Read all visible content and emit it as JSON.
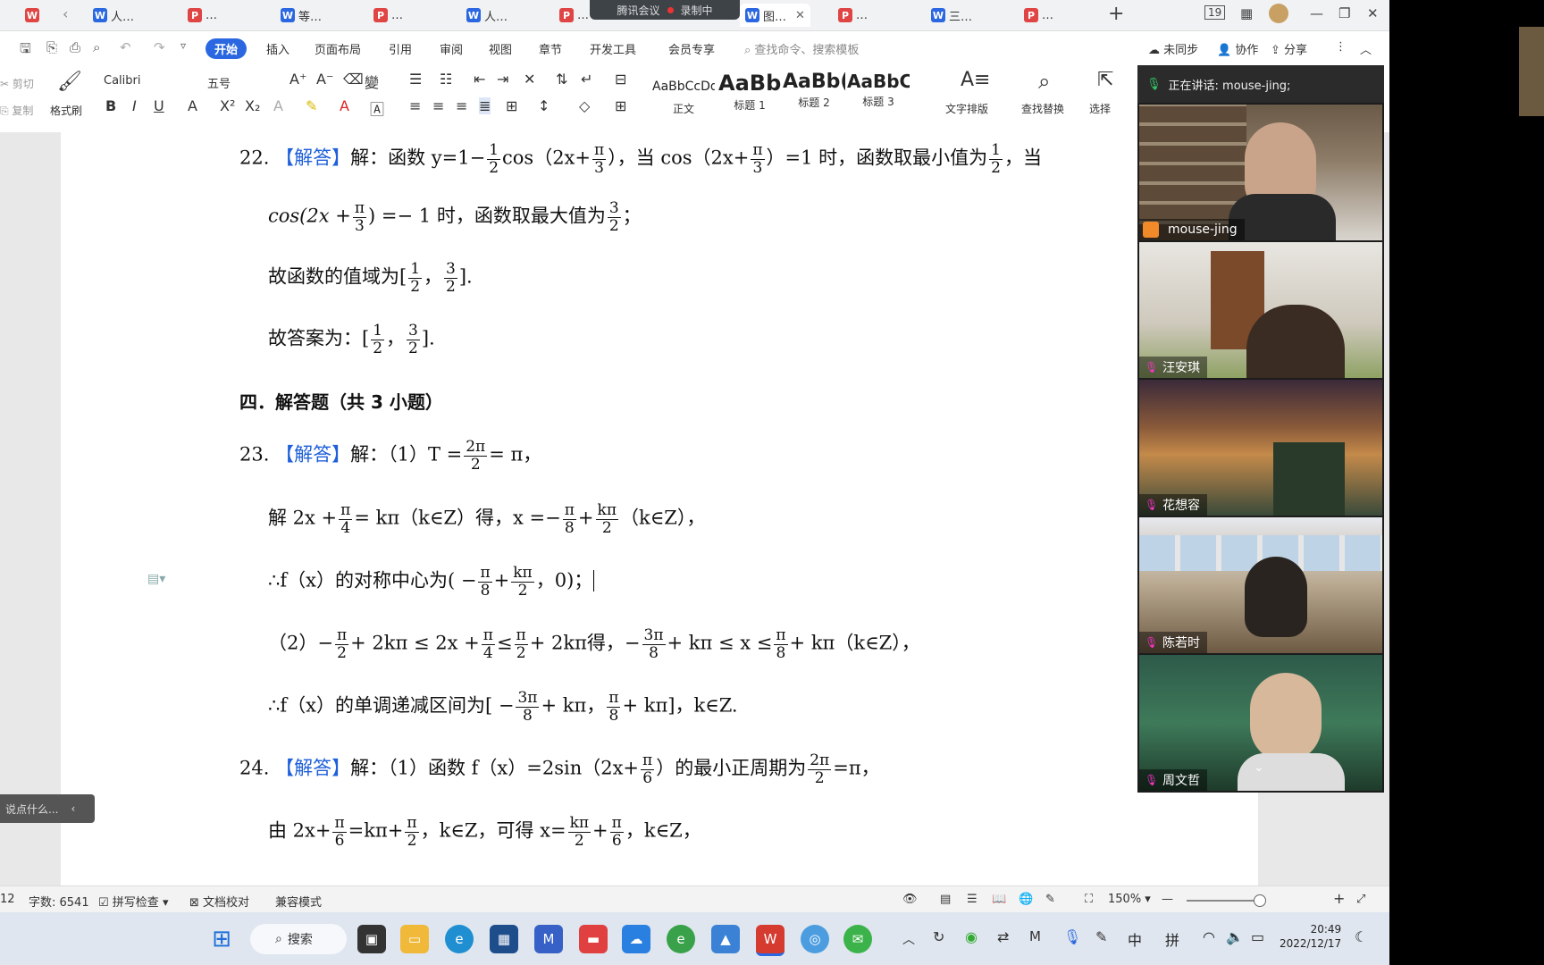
{
  "tabs": [
    {
      "label": "人…",
      "type": "w"
    },
    {
      "label": "…",
      "type": "p"
    },
    {
      "label": "等…",
      "type": "w"
    },
    {
      "label": "…",
      "type": "p"
    },
    {
      "label": "人…",
      "type": "w"
    },
    {
      "label": "…",
      "type": "p"
    },
    {
      "label": "图…",
      "type": "w",
      "active": true
    },
    {
      "label": "…",
      "type": "p"
    },
    {
      "label": "三…",
      "type": "w"
    },
    {
      "label": "…",
      "type": "p"
    }
  ],
  "meeting": {
    "app": "腾讯会议",
    "recording": "录制中"
  },
  "window": {
    "badge": "19"
  },
  "menu": {
    "items": [
      "开始",
      "插入",
      "页面布局",
      "引用",
      "审阅",
      "视图",
      "章节",
      "开发工具",
      "会员专享"
    ],
    "search_placeholder": "查找命令、搜索模板",
    "sync": "未同步",
    "collab": "协作",
    "share": "分享"
  },
  "ribbon": {
    "cut": "剪切",
    "copy": "复制",
    "format_painter": "格式刷",
    "font": "Calibri",
    "size": "五号",
    "styles": [
      {
        "preview": "AaBbCcDd",
        "label": "正文"
      },
      {
        "preview": "AaBb",
        "label": "标题 1"
      },
      {
        "preview": "AaBb(",
        "label": "标题 2"
      },
      {
        "preview": "AaBbC",
        "label": "标题 3"
      }
    ],
    "text_layout": "文字排版",
    "find_replace": "查找替换",
    "select": "选择"
  },
  "doc": {
    "l1a": "22.",
    "l1b": "【解答】",
    "l1c": "解：函数 y=1−",
    "l1d": "cos（2x+",
    "l1e": "），当 cos（2x+",
    "l1f": "）=1 时，函数取最小值为",
    "l1g": "，当",
    "l2a": "cos(2x +",
    "l2b": ") =− 1 时，函数取最大值为",
    "l2c": "；",
    "l3a": "故函数的值域为[",
    "l3b": "，",
    "l3c": "].",
    "l4a": "故答案为：[",
    "l4b": "，",
    "l4c": "].",
    "sec": "四．解答题（共 3 小题）",
    "l5a": "23.",
    "l5b": "【解答】",
    "l5c": "解：（1）T =",
    "l5d": "= π，",
    "l6a": "解 2x +",
    "l6b": "= kπ（k∈Z）得，x =−",
    "l6c": "+",
    "l6d": "（k∈Z），",
    "l7a": "∴f（x）的对称中心为( −",
    "l7b": "+",
    "l7c": "，0)；",
    "l8a": "（2）−",
    "l8b": "+ 2kπ ≤ 2x +",
    "l8c": "≤",
    "l8d": "+ 2kπ得，−",
    "l8e": "+ kπ ≤ x ≤",
    "l8f": "+ kπ（k∈Z），",
    "l9a": "∴f（x）的单调递减区间为[ −",
    "l9b": "+ kπ，",
    "l9c": "+ kπ]，k∈Z.",
    "l10a": "24.",
    "l10b": "【解答】",
    "l10c": "解：（1）函数 f（x）=2sin（2x+",
    "l10d": "）的最小正周期为",
    "l10e": "=π，",
    "l11a": "由 2x+",
    "l11b": "=kπ+",
    "l11c": "，k∈Z，可得 x=",
    "l11d": "+",
    "l11e": "，k∈Z，",
    "f": {
      "one": "1",
      "two": "2",
      "three": "3",
      "four": "4",
      "six": "6",
      "eight": "8",
      "pi": "π",
      "twopi": "2π",
      "kpi": "kπ",
      "threepi": "3π"
    }
  },
  "video": {
    "speaking": "正在讲话: mouse-jing;",
    "participants": [
      "mouse-jing",
      "汪安琪",
      "花想容",
      "陈若时",
      "周文哲"
    ]
  },
  "chat": {
    "placeholder": "说点什么..."
  },
  "status": {
    "page": "12",
    "words": "字数: 6541",
    "spell": "拼写检查",
    "proof": "文档校对",
    "compat": "兼容模式",
    "zoom": "150%"
  },
  "taskbar": {
    "search": "搜索",
    "ime1": "中",
    "ime2": "拼",
    "time": "20:49",
    "date": "2022/12/17"
  },
  "colors": {
    "accent": "#2a67e0",
    "answer": "#1f5fd9",
    "pdf": "#e04545"
  }
}
